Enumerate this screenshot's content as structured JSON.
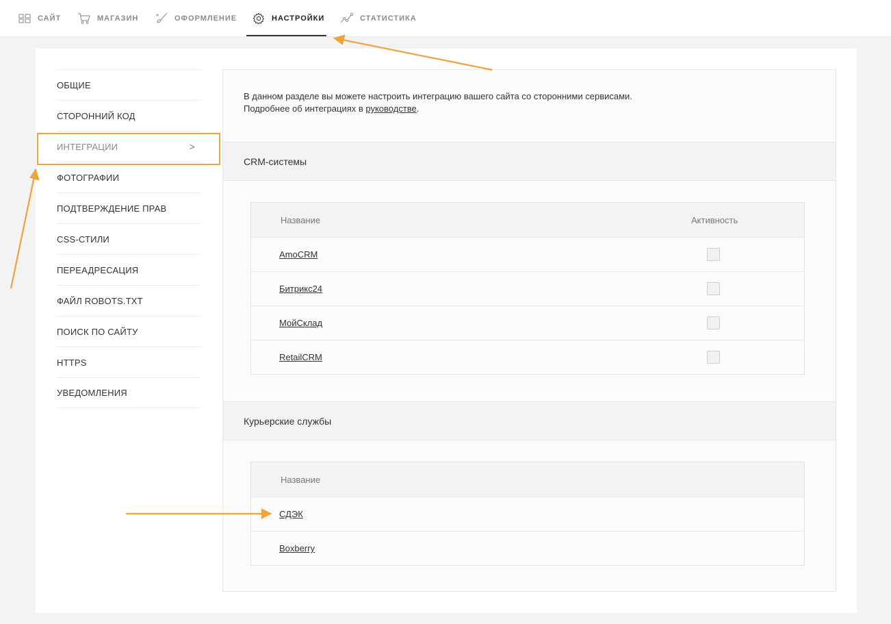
{
  "nav": {
    "items": [
      {
        "label": "САЙТ",
        "icon": "grid-icon"
      },
      {
        "label": "МАГАЗИН",
        "icon": "cart-icon"
      },
      {
        "label": "ОФОРМЛЕНИЕ",
        "icon": "brush-icon"
      },
      {
        "label": "НАСТРОЙКИ",
        "icon": "gear-icon",
        "active": true
      },
      {
        "label": "СТАТИСТИКА",
        "icon": "chart-line-icon"
      }
    ]
  },
  "sidebar": {
    "items": [
      {
        "label": "ОБЩИЕ"
      },
      {
        "label": "СТОРОННИЙ КОД"
      },
      {
        "label": "ИНТЕГРАЦИИ",
        "active": true,
        "chevron": ">"
      },
      {
        "label": "ФОТОГРАФИИ"
      },
      {
        "label": "ПОДТВЕРЖДЕНИЕ ПРАВ"
      },
      {
        "label": "CSS-СТИЛИ"
      },
      {
        "label": "ПЕРЕАДРЕСАЦИЯ"
      },
      {
        "label": "ФАЙЛ ROBOTS.TXT"
      },
      {
        "label": "ПОИСК ПО САЙТУ"
      },
      {
        "label": "HTTPS"
      },
      {
        "label": "УВЕДОМЛЕНИЯ"
      }
    ]
  },
  "intro": {
    "line1": "В данном разделе вы можете настроить интеграцию вашего сайта со сторонними сервисами.",
    "line2_prefix": "Подробнее об интеграциях в ",
    "line2_link": "руководстве",
    "line2_suffix": "."
  },
  "crm": {
    "title": "CRM-системы",
    "col_name": "Название",
    "col_active": "Активность",
    "rows": [
      {
        "name": "AmoCRM",
        "active": false
      },
      {
        "name": "Битрикс24",
        "active": false
      },
      {
        "name": "МойСклад",
        "active": false
      },
      {
        "name": "RetailCRM",
        "active": false
      }
    ]
  },
  "courier": {
    "title": "Курьерские службы",
    "col_name": "Название",
    "rows": [
      {
        "name": "СДЭК"
      },
      {
        "name": "Boxberry"
      }
    ]
  },
  "colors": {
    "accent": "#efa33a",
    "background": "#f3f3f3"
  }
}
